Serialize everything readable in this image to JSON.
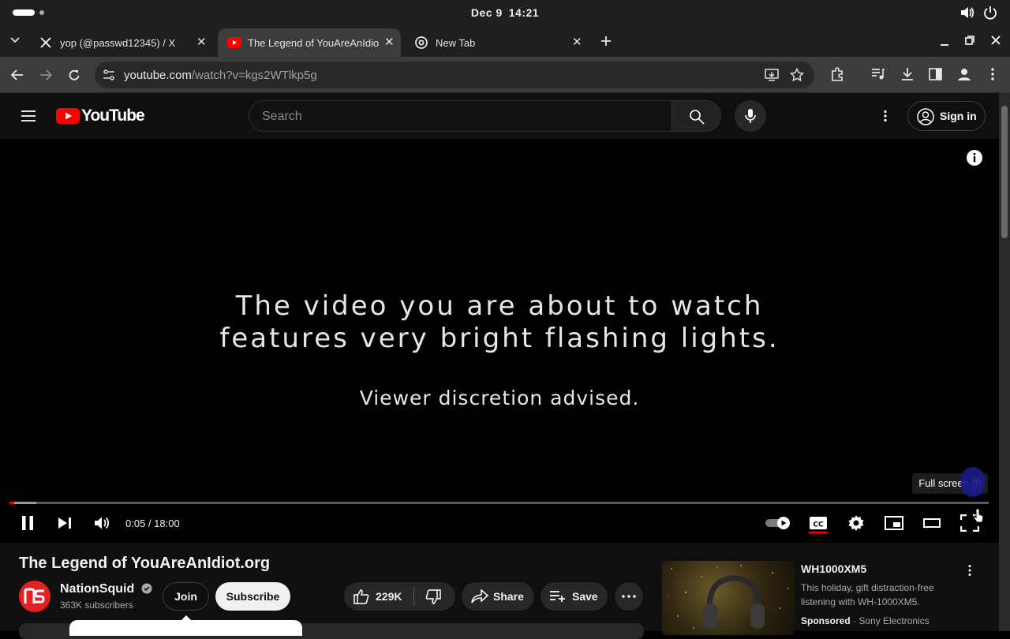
{
  "os": {
    "date": "Dec 9",
    "time": "14:21"
  },
  "tabs": [
    {
      "title": "yop (@passwd12345) / X",
      "icon": "x-logo-icon"
    },
    {
      "title": "The Legend of YouAreAnIdiot.org - YouTube",
      "icon": "youtube-favicon-icon",
      "active": true
    },
    {
      "title": "New Tab",
      "icon": "chrome-icon"
    }
  ],
  "address": {
    "host": "youtube.com",
    "path": "/watch?v=kgs2WTlkp5g"
  },
  "youtube": {
    "logo_text": "YouTube",
    "search_placeholder": "Search",
    "sign_in": "Sign in"
  },
  "video": {
    "line1": "The video you are about to watch",
    "line2": "features very bright flashing lights.",
    "line3": "Viewer discretion advised.",
    "time": "0:05 / 18:00",
    "progress_fraction": 0.0046,
    "tooltip": "Full screen (f)"
  },
  "details": {
    "title": "The Legend of YouAreAnIdiot.org",
    "channel": "NationSquid",
    "subscribers": "363K subscribers",
    "join": "Join",
    "subscribe": "Subscribe",
    "likes": "229K",
    "share": "Share",
    "save": "Save"
  },
  "ad": {
    "title": "WH1000XM5",
    "description": "This holiday, gift distraction-free listening with WH-1000XM5.",
    "sponsored": "Sponsored",
    "advertiser": "Sony Electronics"
  },
  "colors": {
    "youtube_red": "#ff0000",
    "background": "#0f0f0f"
  }
}
